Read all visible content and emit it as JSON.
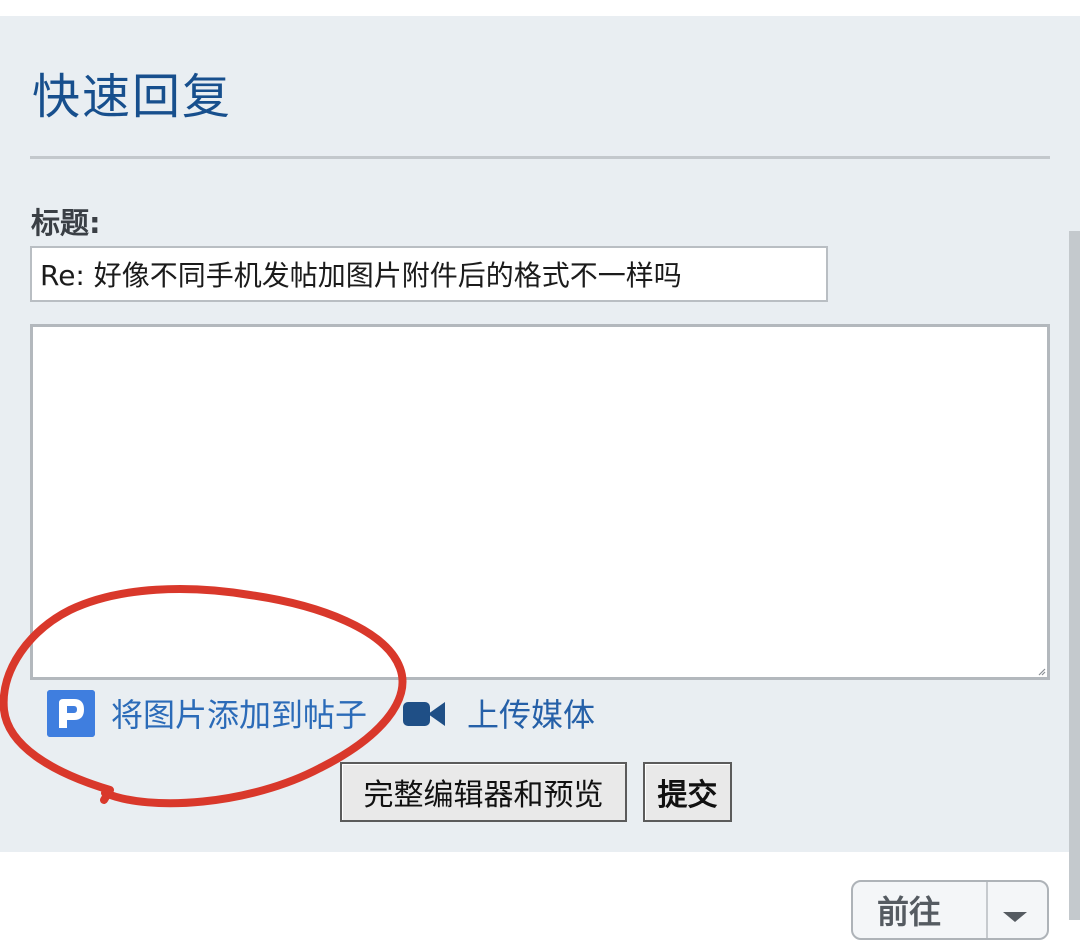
{
  "quick_reply": {
    "title": "快速回复",
    "subject_label": "标题:",
    "subject_value": "Re: 好像不同手机发帖加图片附件后的格式不一样吗",
    "message_value": "",
    "add_image_label": "将图片添加到帖子",
    "upload_media_label": "上传媒体",
    "full_editor_button": "完整编辑器和预览",
    "submit_button": "提交"
  },
  "navigation": {
    "goto_label": "前往"
  },
  "colors": {
    "panel_background": "#e9eef2",
    "title": "#174f8d",
    "link": "#2b6bb8",
    "image_icon": "#3f7edf",
    "media_icon": "#1f4f86",
    "annotation_circle": "#d9382b"
  },
  "icons": {
    "add_image": "photo-p-icon",
    "upload_media": "video-camera-icon",
    "goto_dropdown": "chevron-down-icon",
    "resize": "resize-grip-icon"
  }
}
